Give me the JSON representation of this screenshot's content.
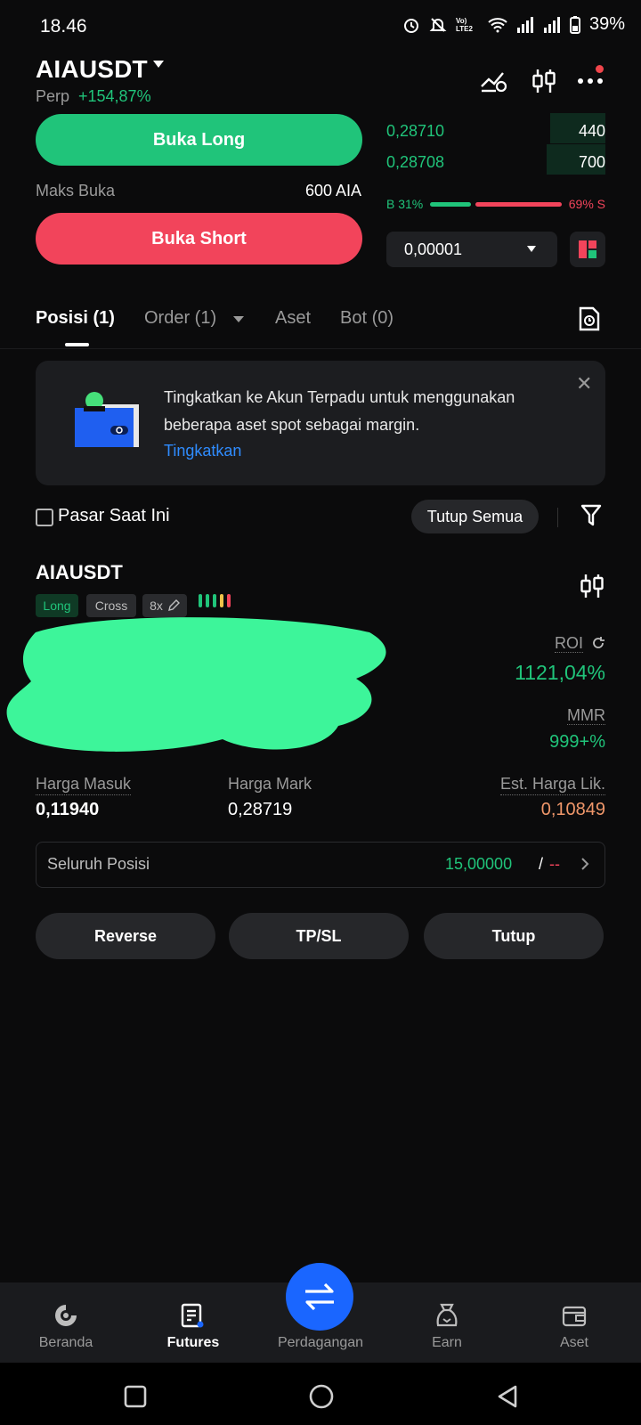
{
  "status_bar": {
    "time": "18.46",
    "network": "Vo) LTE2",
    "battery": "39%"
  },
  "header": {
    "pair": "AIAUSDT",
    "perp_label": "Perp",
    "change": "+154,87%"
  },
  "trade": {
    "long_label": "Buka Long",
    "short_label": "Buka Short",
    "maks_label": "Maks Buka",
    "maks_value": "600 AIA"
  },
  "orderbook": {
    "rows": [
      {
        "price": "0,28710",
        "qty": "440"
      },
      {
        "price": "0,28708",
        "qty": "700"
      }
    ],
    "buy_ratio": "B 31%",
    "sell_ratio": "69% S",
    "tick_size": "0,00001"
  },
  "tabs": [
    {
      "label": "Posisi (1)"
    },
    {
      "label": "Order (1)"
    },
    {
      "label": "Aset"
    },
    {
      "label": "Bot (0)"
    }
  ],
  "banner": {
    "text": "Tingkatkan ke Akun Terpadu untuk menggunakan beberapa aset spot sebagai margin.",
    "link": "Tingkatkan"
  },
  "filters": {
    "current_market": "Pasar Saat Ini",
    "close_all": "Tutup Semua"
  },
  "position": {
    "pair": "AIAUSDT",
    "side": "Long",
    "margin_mode": "Cross",
    "leverage": "8x",
    "roi_label": "ROI",
    "roi_value": "1121,04%",
    "mmr_label": "MMR",
    "mmr_value": "999+%",
    "entry_label": "Harga Masuk",
    "entry_value": "0,11940",
    "mark_label": "Harga Mark",
    "mark_value": "0,28719",
    "liq_label": "Est. Harga Lik.",
    "liq_value": "0,10849",
    "all_positions_label": "Seluruh Posisi",
    "all_positions_value": "15,00000",
    "all_positions_slash": "/",
    "all_positions_dash": "--",
    "reverse_label": "Reverse",
    "tpsl_label": "TP/SL",
    "close_label": "Tutup"
  },
  "colors": {
    "green": "#20c47a",
    "red": "#f2445b",
    "blue": "#1a66ff",
    "orange": "#f0976a"
  },
  "bottom_nav": [
    {
      "label": "Beranda",
      "icon": "home-icon"
    },
    {
      "label": "Futures",
      "icon": "futures-icon"
    },
    {
      "label": "Perdagangan",
      "icon": "swap-icon"
    },
    {
      "label": "Earn",
      "icon": "earn-icon"
    },
    {
      "label": "Aset",
      "icon": "wallet-icon"
    }
  ]
}
